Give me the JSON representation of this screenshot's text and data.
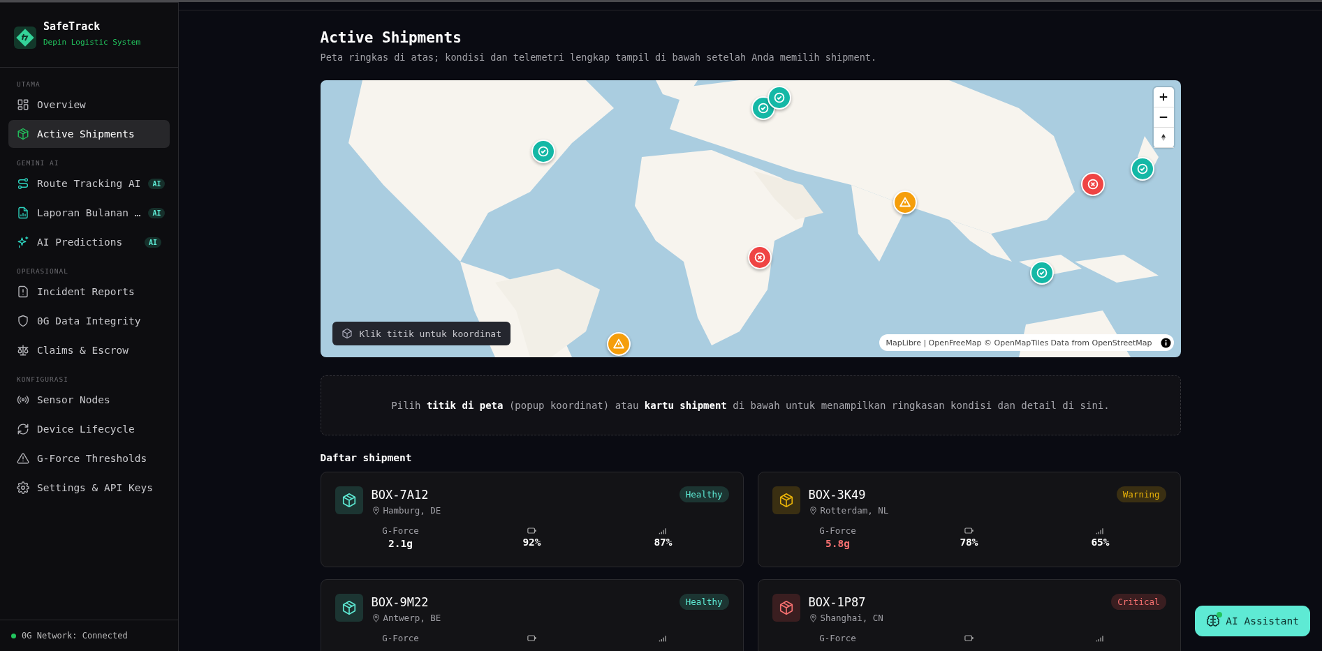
{
  "brand": {
    "name": "SafeTrack",
    "tagline": "Depin Logistic System"
  },
  "sidebar": {
    "sections": [
      {
        "title": "UTAMA",
        "items": [
          {
            "label": "Overview",
            "selected": false
          },
          {
            "label": "Active Shipments",
            "selected": true
          }
        ]
      },
      {
        "title": "GEMINI AI",
        "items": [
          {
            "label": "Route Tracking AI",
            "selected": false,
            "badge": "AI"
          },
          {
            "label": "Laporan Bulanan …",
            "selected": false,
            "badge": "AI"
          },
          {
            "label": "AI Predictions",
            "selected": false,
            "badge": "AI"
          }
        ]
      },
      {
        "title": "OPERASIONAL",
        "items": [
          {
            "label": "Incident Reports",
            "selected": false
          },
          {
            "label": "0G Data Integrity",
            "selected": false
          },
          {
            "label": "Claims & Escrow",
            "selected": false
          }
        ]
      },
      {
        "title": "KONFIGURASI",
        "items": [
          {
            "label": "Sensor Nodes",
            "selected": false
          },
          {
            "label": "Device Lifecycle",
            "selected": false
          },
          {
            "label": "G-Force Thresholds",
            "selected": false
          },
          {
            "label": "Settings & API Keys",
            "selected": false
          }
        ]
      }
    ],
    "network_status": {
      "label": "0G Network: Connected",
      "connected": true
    }
  },
  "page": {
    "title": "Active Shipments",
    "subtitle": "Peta ringkas di atas; kondisi dan telemetri lengkap tampil di bawah setelah Anda memilih shipment."
  },
  "map": {
    "hint": "Klik titik untuk koordinat",
    "attribution": "MapLibre | OpenFreeMap © OpenMapTiles Data from OpenStreetMap",
    "markers": [
      {
        "kind": "healthy"
      },
      {
        "kind": "healthy"
      },
      {
        "kind": "healthy"
      },
      {
        "kind": "critical"
      },
      {
        "kind": "warning"
      },
      {
        "kind": "warning"
      },
      {
        "kind": "critical"
      },
      {
        "kind": "healthy"
      },
      {
        "kind": "healthy"
      }
    ]
  },
  "info": "Pilih **titik di peta** (popup koordinat) atau **kartu shipment** di bawah untuk menampilkan ringkasan kondisi dan detail di sini.",
  "shipments_title": "Daftar shipment",
  "shipments": [
    {
      "id": "BOX-7A12",
      "location": "Hamburg, DE",
      "kind": "healthy",
      "status_label": "Healthy",
      "g_force_label": "G-Force",
      "g_force": "2.1g",
      "g_force_high": false,
      "battery": "92%",
      "signal": "87%"
    },
    {
      "id": "BOX-3K49",
      "location": "Rotterdam, NL",
      "kind": "warning",
      "status_label": "Warning",
      "g_force_label": "G-Force",
      "g_force": "5.8g",
      "g_force_high": true,
      "battery": "78%",
      "signal": "65%"
    },
    {
      "id": "BOX-9M22",
      "location": "Antwerp, BE",
      "kind": "healthy",
      "status_label": "Healthy",
      "g_force_label": "G-Force"
    },
    {
      "id": "BOX-1P87",
      "location": "Shanghai, CN",
      "kind": "critical",
      "status_label": "Critical",
      "g_force_label": "G-Force"
    }
  ],
  "assistant_button": {
    "label": "AI Assistant",
    "online": true
  }
}
